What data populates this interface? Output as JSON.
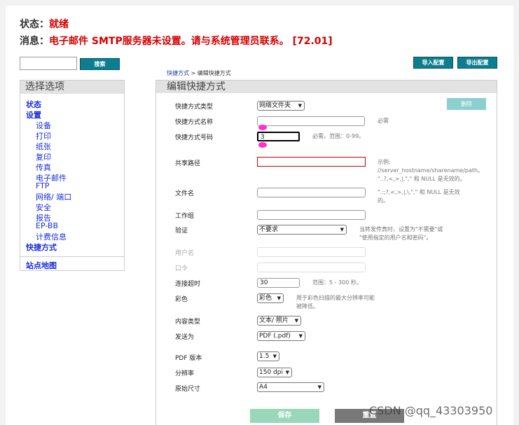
{
  "status": {
    "label": "状态：",
    "value": "就绪"
  },
  "message": {
    "label": "消息：",
    "value": "电子邮件 SMTP服务器未设置。请与系统管理员联系。 [72.01]"
  },
  "toolbar": {
    "search_label": "搜索",
    "import_label": "导入配置",
    "export_label": "导出配置",
    "search_value": ""
  },
  "breadcrumb": {
    "link": "快捷方式",
    "separator": " > ",
    "current": "编辑快捷方式"
  },
  "sidebar": {
    "title": "选择选项",
    "items": [
      "状态",
      "设置",
      "设备",
      "打印",
      "纸张",
      "复印",
      "传真",
      "电子邮件",
      "FTP",
      "网络/ 端口",
      "安全",
      "报告",
      "EP-BB",
      "计费信息",
      "快捷方式",
      "站点地图"
    ]
  },
  "panel": {
    "title": "编辑快捷方式",
    "delete_label": "删除"
  },
  "form": {
    "type_label": "快捷方式类型",
    "type_value": "网络文件夹",
    "name_label": "快捷方式名称",
    "name_value": "",
    "name_hint": "必需",
    "number_label": "快捷方式号码",
    "number_value": "3",
    "number_hint": "必需。范围：0-99。",
    "share_label": "共享路径",
    "share_value": "",
    "share_hint": [
      "示例:",
      "//server_hostname/sharename/path。",
      "\"..?,<,>,|,\",\" 和 NULL 是无效的。"
    ],
    "filename_label": "文件名",
    "filename_value": "",
    "filename_hint": [
      "\".:;?,<,>,|,\\,\",\" 和 NULL 是无效",
      "的。"
    ],
    "workgroup_label": "工作组",
    "workgroup_value": "",
    "auth_label": "验证",
    "auth_value": "不要求",
    "auth_hint": [
      "当转发传真时，设置为\"不需要\"或",
      "\"使用指定的用户名和密码\"。"
    ],
    "user_label": "用户名",
    "password_label": "口令",
    "timeout_label": "连接超时",
    "timeout_value": "30",
    "timeout_hint": "范围：5 - 300 秒。",
    "color_label": "彩色",
    "color_value": "彩色",
    "color_hint": [
      "用于彩色扫描的最大分辨率可能",
      "被降低。"
    ],
    "content_label": "内容类型",
    "content_value": "文本/ 照片",
    "sendas_label": "发送为",
    "sendas_value": "PDF (.pdf)",
    "pdfver_label": "PDF 版本",
    "pdfver_value": "1.5",
    "resolution_label": "分辨率",
    "resolution_value": "150 dpi",
    "size_label": "原始尺寸",
    "size_value": "A4"
  },
  "actions": {
    "save_label": "保存",
    "reset_label": "重置"
  },
  "watermark": "CSDN @qq_43303950",
  "colors": {
    "accent": "#0d7e8f",
    "alert": "#d40000",
    "link": "#1a2fd8",
    "marker": "#ff2fd2"
  }
}
